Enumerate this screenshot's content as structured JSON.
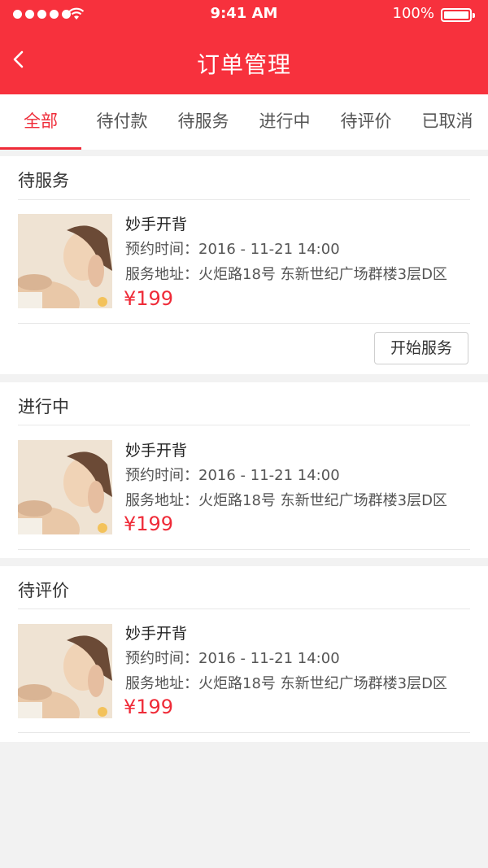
{
  "status_bar": {
    "time": "9:41 AM",
    "battery": "100%"
  },
  "header": {
    "title": "订单管理"
  },
  "tabs": [
    "全部",
    "待付款",
    "待服务",
    "进行中",
    "待评价",
    "已取消"
  ],
  "orders": [
    {
      "status": "待服务",
      "name": "妙手开背",
      "appointment": "预约时间：2016 - 11-21 14:00",
      "address": "服务地址：火炬路18号 东新世纪广场群楼3层D区",
      "price": "¥199",
      "action": "开始服务"
    },
    {
      "status": "进行中",
      "name": "妙手开背",
      "appointment": "预约时间：2016 - 11-21 14:00",
      "address": "服务地址：火炬路18号 东新世纪广场群楼3层D区",
      "price": "¥199"
    },
    {
      "status": "待评价",
      "name": "妙手开背",
      "appointment": "预约时间：2016 - 11-21 14:00",
      "address": "服务地址：火炬路18号 东新世纪广场群楼3层D区",
      "price": "¥199"
    }
  ],
  "colors": {
    "brand": "#f7313d",
    "accent": "#ef2b38",
    "background": "#f2f2f2"
  }
}
